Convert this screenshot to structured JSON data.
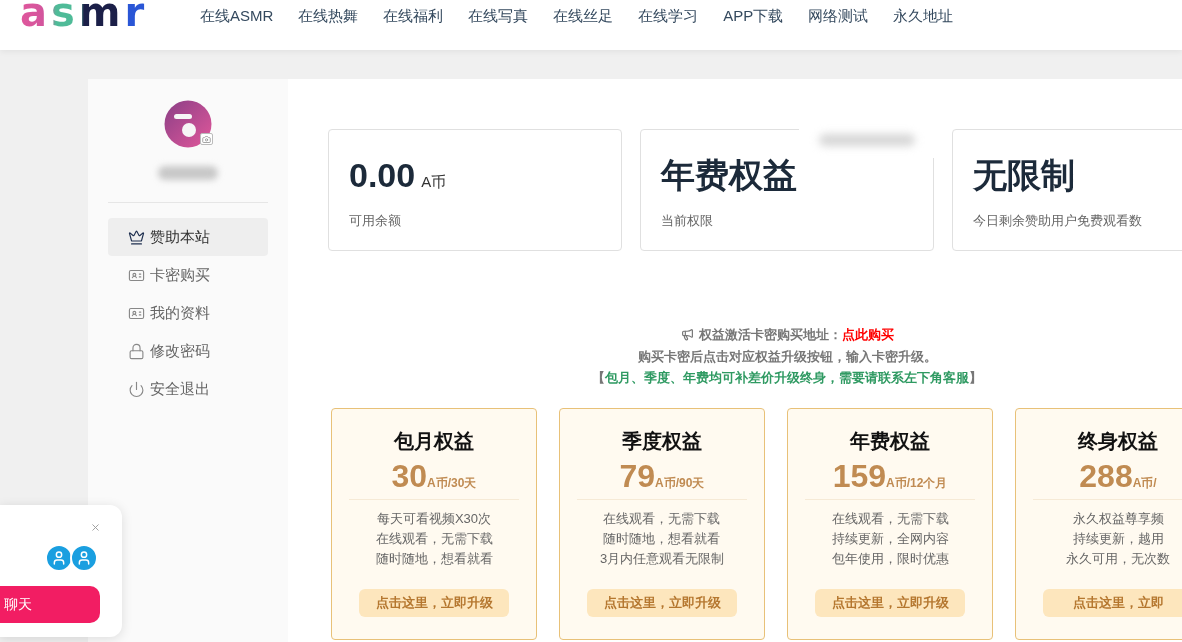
{
  "header": {
    "logo": "asmr",
    "nav": [
      "在线ASMR",
      "在线热舞",
      "在线福利",
      "在线写真",
      "在线丝足",
      "在线学习",
      "APP下载",
      "网络测试",
      "永久地址"
    ]
  },
  "sidebar": {
    "menu": [
      {
        "label": "赞助本站",
        "selected": true
      },
      {
        "label": "卡密购买",
        "selected": false
      },
      {
        "label": "我的资料",
        "selected": false
      },
      {
        "label": "修改密码",
        "selected": false
      },
      {
        "label": "安全退出",
        "selected": false
      }
    ]
  },
  "stats": [
    {
      "value": "0.00",
      "unit": "A币",
      "label": "可用余额"
    },
    {
      "value": "年费权益",
      "label": "当前权限"
    },
    {
      "value": "无限制",
      "label": "今日剩余赞助用户免费观看数"
    }
  ],
  "notice": {
    "line_1": {
      "text": "权益激活卡密购买地址：",
      "link": "点此购买"
    },
    "line_2": "购买卡密后点击对应权益升级按钮，输入卡密升级。",
    "line_3": {
      "open": "【",
      "text": "包月、季度、年费均可补差价升级终身，需要请联系左下角客服",
      "close": "】"
    }
  },
  "plans": [
    {
      "title": "包月权益",
      "price": "30",
      "unit": "A币/30天",
      "features": [
        "每天可看视频X30次",
        "在线观看，无需下载",
        "随时随地，想看就看"
      ],
      "button": "点击这里，立即升级"
    },
    {
      "title": "季度权益",
      "price": "79",
      "unit": "A币/90天",
      "features": [
        "在线观看，无需下载",
        "随时随地，想看就看",
        "3月内任意观看无限制"
      ],
      "button": "点击这里，立即升级"
    },
    {
      "title": "年费权益",
      "price": "159",
      "unit": "A币/12个月",
      "features": [
        "在线观看，无需下载",
        "持续更新，全网内容",
        "包年使用，限时优惠"
      ],
      "button": "点击这里，立即升级"
    },
    {
      "title": "终身权益",
      "price": "288",
      "unit": "A币/",
      "features": [
        "永久权益尊享频",
        "持续更新，越用",
        "永久可用，无次数"
      ],
      "button": "点击这里，立即"
    }
  ],
  "chat_widget": {
    "button": "聊天"
  }
}
